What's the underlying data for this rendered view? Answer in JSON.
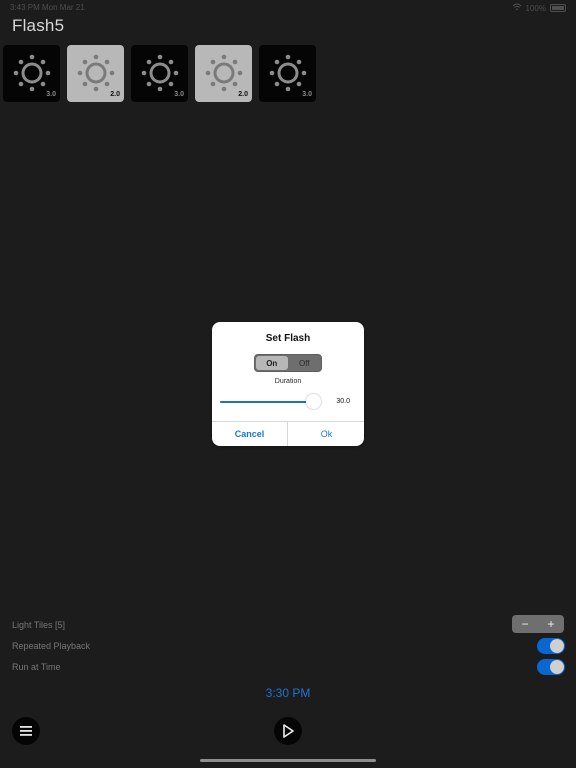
{
  "status_bar": {
    "time_date": "3:43 PM   Mon Mar 21",
    "battery": "100%"
  },
  "app": {
    "title": "Flash5"
  },
  "tiles": [
    {
      "value": "3.0",
      "theme": "dark"
    },
    {
      "value": "2.0",
      "theme": "light"
    },
    {
      "value": "3.0",
      "theme": "dark"
    },
    {
      "value": "2.0",
      "theme": "light"
    },
    {
      "value": "3.0",
      "theme": "dark"
    }
  ],
  "dialog": {
    "title": "Set Flash",
    "segment_on": "On",
    "segment_off": "Off",
    "selected_segment": "On",
    "duration_label": "Duration",
    "duration_value": "30.0",
    "duration_fraction": 0.95,
    "cancel_label": "Cancel",
    "ok_label": "Ok"
  },
  "settings": {
    "light_tiles_label": "Light Tiles [5]",
    "repeated_playback_label": "Repeated Playback",
    "run_at_time_label": "Run at Time",
    "stepper_minus": "−",
    "stepper_plus": "+",
    "repeated_playback_on": true,
    "run_at_time_on": true
  },
  "schedule": {
    "time": "3:30 PM"
  },
  "colors": {
    "background": "#1c1c1c",
    "accent": "#1677d2",
    "toggle_on": "#0b67d0"
  },
  "icons": {
    "tile_icon": "flash-light-icon",
    "menu_icon": "menu-icon",
    "play_icon": "play-icon",
    "wifi_icon": "wifi-icon",
    "battery_icon": "battery-icon"
  }
}
